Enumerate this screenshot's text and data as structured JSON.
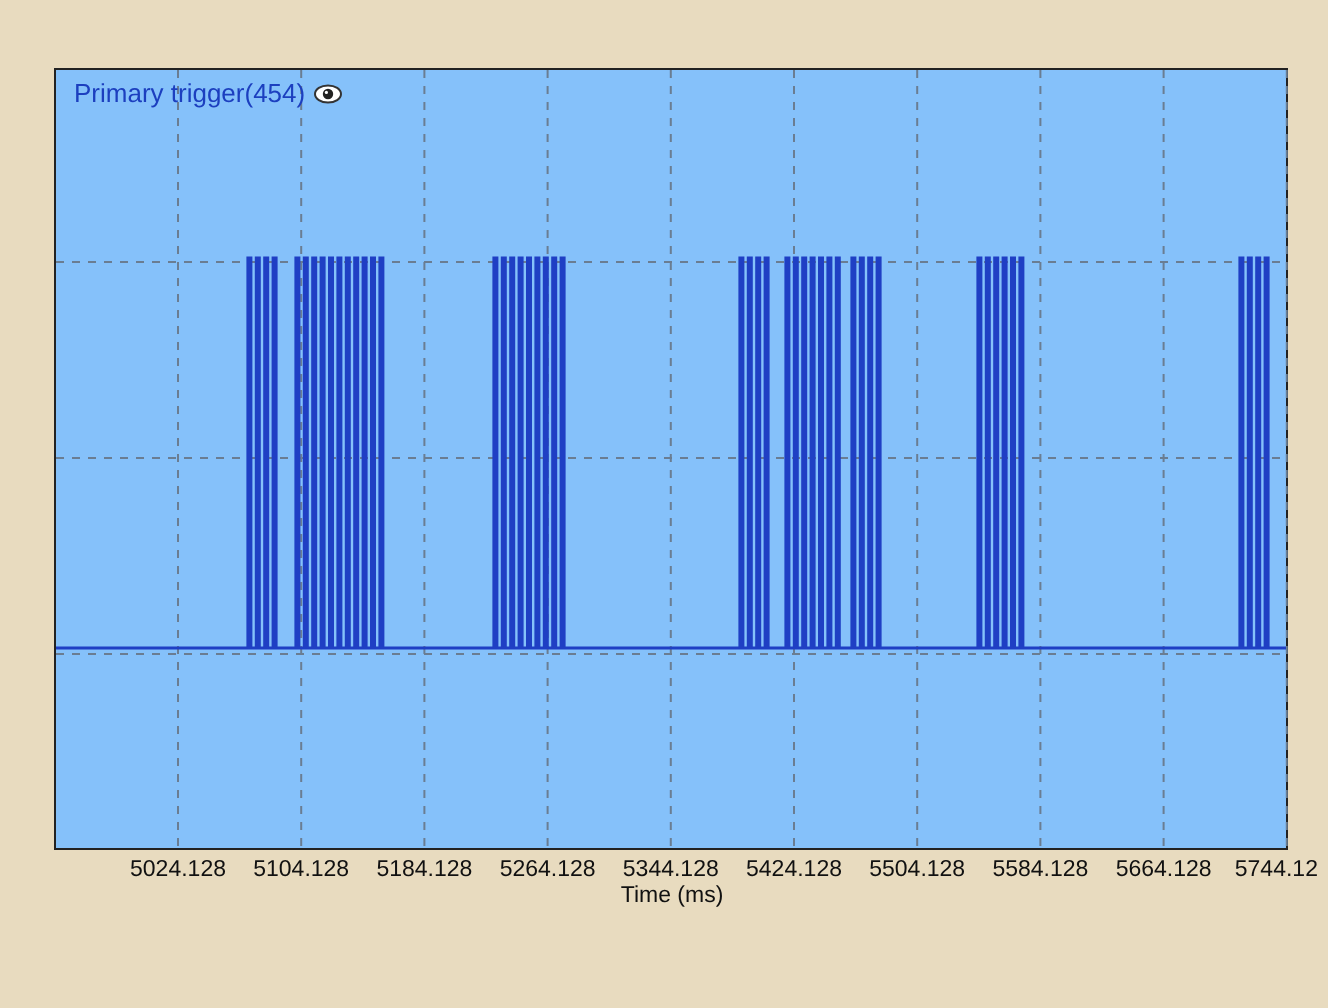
{
  "chart": {
    "title": "Primary trigger(454)",
    "x_ticks": [
      "5024.128",
      "5104.128",
      "5184.128",
      "5264.128",
      "5344.128",
      "5424.128",
      "5504.128",
      "5584.128",
      "5664.128",
      "5744.12"
    ],
    "xlabel": "Time (ms)"
  }
}
